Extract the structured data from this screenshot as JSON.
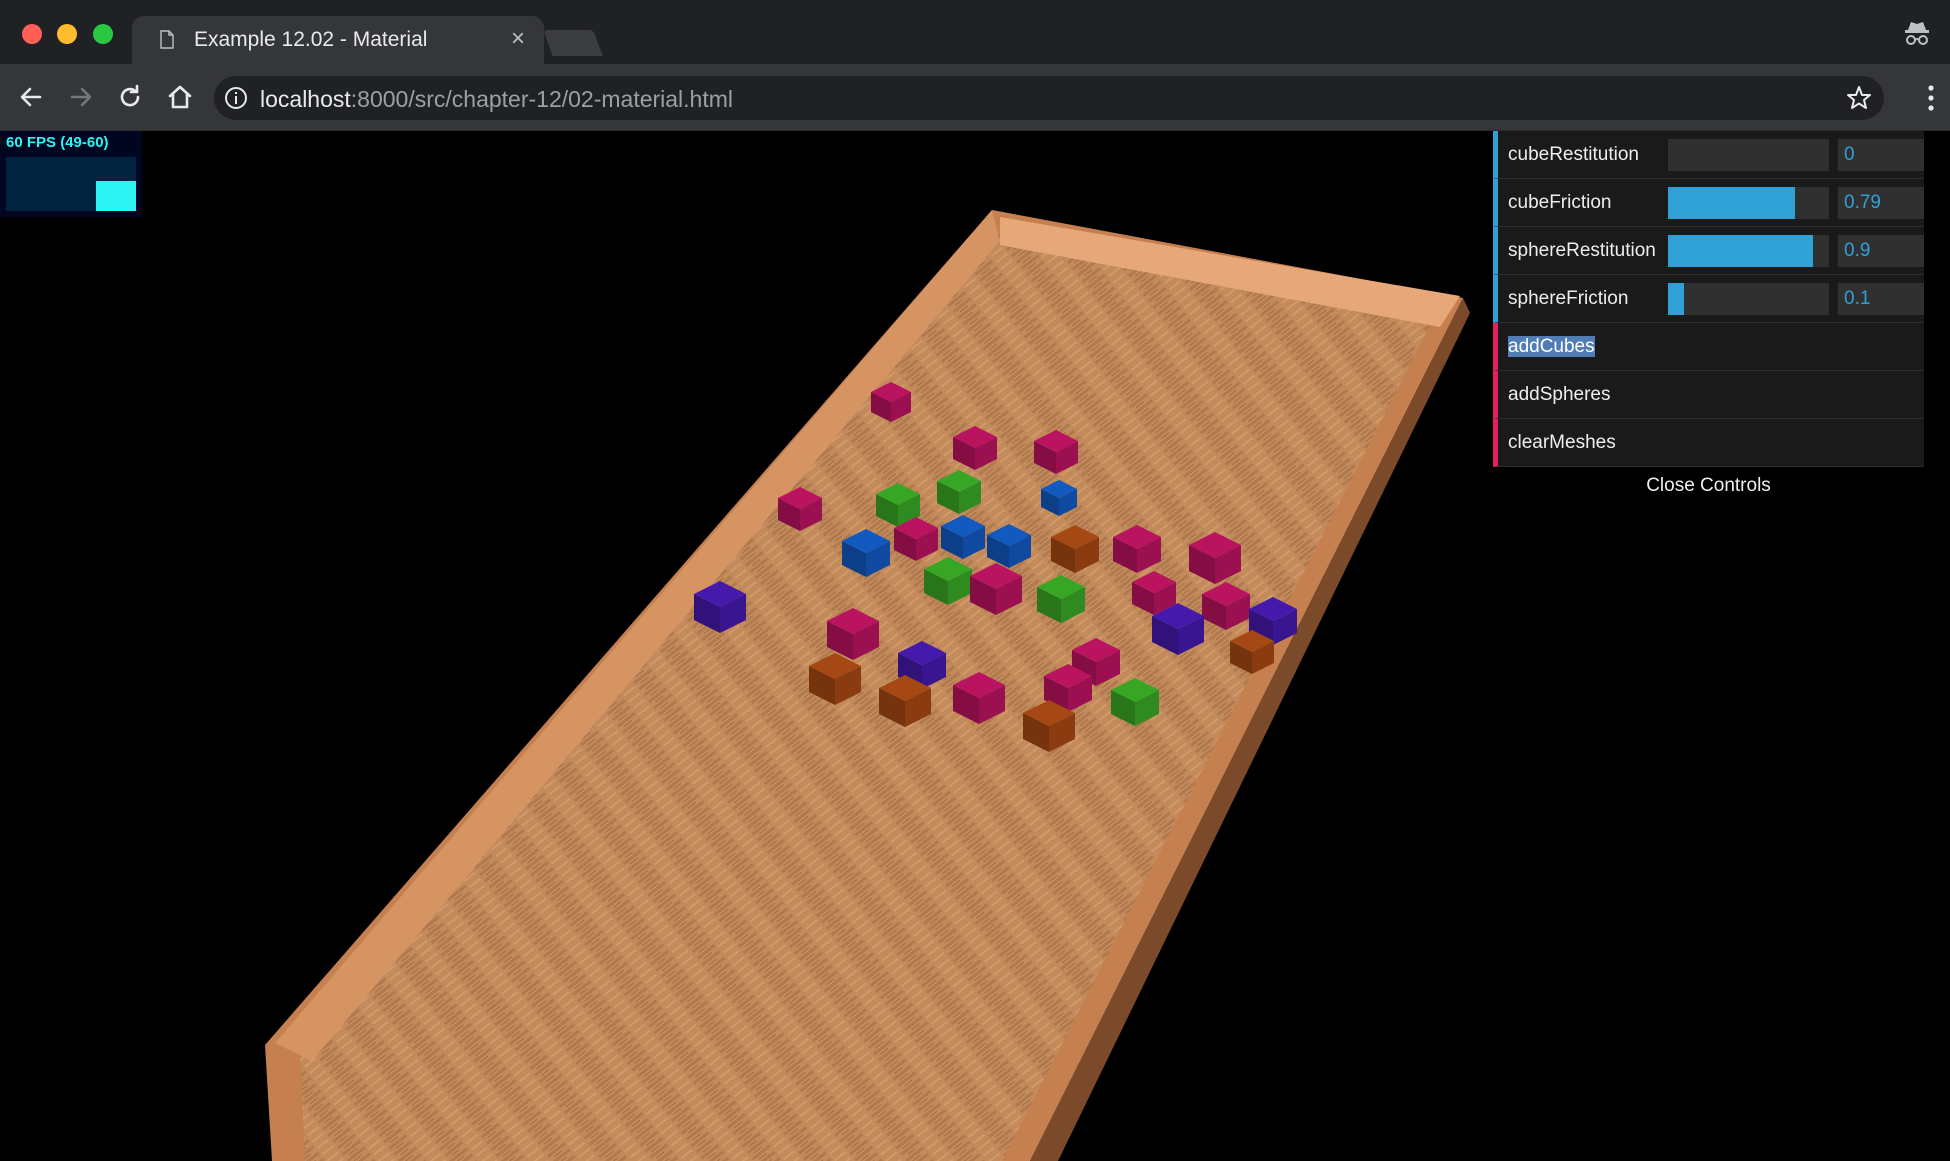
{
  "browser": {
    "tab_title": "Example 12.02 - Material",
    "tab_close": "×",
    "url_host": "localhost",
    "url_rest": ":8000/src/chapter-12/02-material.html"
  },
  "stats": {
    "fps_label": "60 FPS (49-60)"
  },
  "gui": {
    "controllers": [
      {
        "label": "cubeRestitution",
        "value": "0",
        "min": 0,
        "max": 1,
        "fraction": 0.0
      },
      {
        "label": "cubeFriction",
        "value": "0.79",
        "min": 0,
        "max": 1,
        "fraction": 0.79
      },
      {
        "label": "sphereRestitution",
        "value": "0.9",
        "min": 0,
        "max": 1,
        "fraction": 0.9
      },
      {
        "label": "sphereFriction",
        "value": "0.1",
        "min": 0,
        "max": 1,
        "fraction": 0.1
      }
    ],
    "functions": [
      {
        "label": "addCubes",
        "selected": true
      },
      {
        "label": "addSpheres",
        "selected": false
      },
      {
        "label": "clearMeshes",
        "selected": false
      }
    ],
    "close_label": "Close Controls"
  },
  "scene": {
    "cube_colors": {
      "crimson": "#9b1050",
      "green": "#2f8a1f",
      "blue": "#0f4aa0",
      "orange": "#8a3c10",
      "purple": "#3a1590"
    },
    "floor_color": "#c08555",
    "wall_color": "#d49060"
  },
  "colors": {
    "gui_accent": "#2fa1d6",
    "gui_function": "#e61d5f",
    "fps_accent": "#2df3f2"
  }
}
